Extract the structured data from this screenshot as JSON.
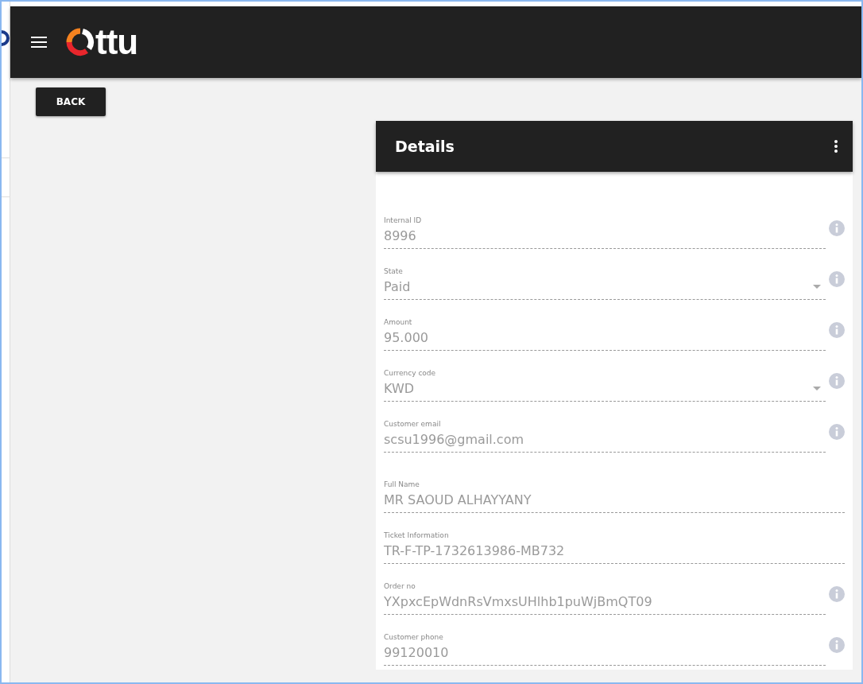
{
  "header": {
    "logo_text": "ttu"
  },
  "back_button": "BACK",
  "card": {
    "title": "Details",
    "fields": [
      {
        "label": "Internal ID",
        "value": "8996",
        "kind": "text",
        "info": true
      },
      {
        "label": "State",
        "value": "Paid",
        "kind": "select",
        "info": true
      },
      {
        "label": "Amount",
        "value": "95.000",
        "kind": "text",
        "info": true
      },
      {
        "label": "Currency code",
        "value": "KWD",
        "kind": "select",
        "info": true
      },
      {
        "label": "Customer email",
        "value": "scsu1996@gmail.com",
        "kind": "text",
        "info": true
      },
      {
        "label": "Full Name",
        "value": "MR SAOUD ALHAYYANY",
        "kind": "text",
        "info": false
      },
      {
        "label": "Ticket Information",
        "value": "TR-F-TP-1732613986-MB732",
        "kind": "text",
        "info": false
      },
      {
        "label": "Order no",
        "value": "YXpxcEpWdnRsVmxsUHlhb1puWjBmQT09",
        "kind": "text",
        "info": true
      },
      {
        "label": "Customer phone",
        "value": "99120010",
        "kind": "text",
        "info": true
      }
    ]
  }
}
